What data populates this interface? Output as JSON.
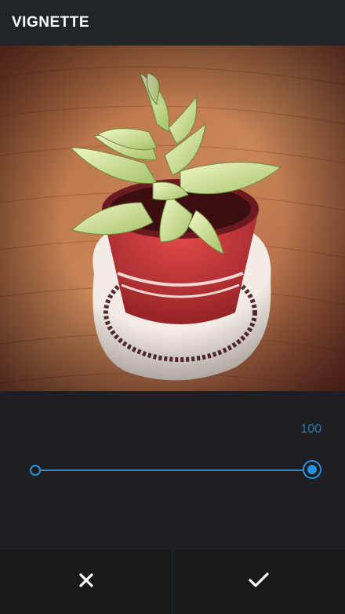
{
  "header": {
    "title": "VIGNETTE"
  },
  "photo": {
    "subject": "succulent-plant-photo"
  },
  "slider": {
    "value": "100",
    "level": 1.0,
    "accent_color": "#2d90dc"
  },
  "footer": {
    "cancel_icon": "close-icon",
    "confirm_icon": "check-icon"
  }
}
